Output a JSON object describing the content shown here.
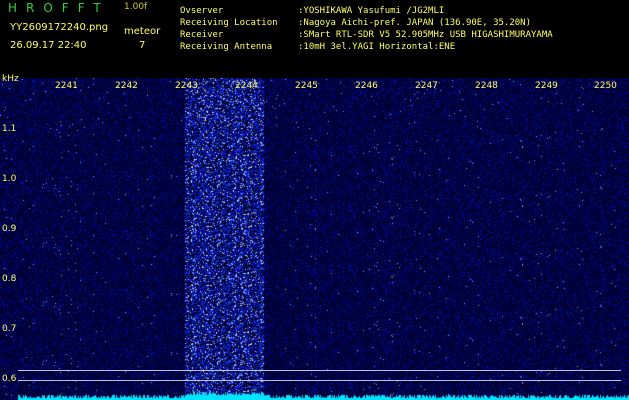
{
  "header": {
    "logo": "HROFFT",
    "version": "1.00f",
    "filename": "YY2609172240.png",
    "timestamp": "26.09.17 22:40",
    "meteor_label": "meteor",
    "meteor_count": "7"
  },
  "info": [
    {
      "label": "Ovserver",
      "value": ":YOSHIKAWA Yasufumi /JG2MLI"
    },
    {
      "label": "Receiving Location",
      "value": ":Nagoya Aichi-pref. JAPAN (136.90E, 35.20N)"
    },
    {
      "label": "Receiver",
      "value": ":SMart RTL-SDR V5 52.905MHz USB HIGASHIMURAYAMA"
    },
    {
      "label": "Receiving Antenna",
      "value": ":10mH 3el.YAGI Horizontal:ENE"
    }
  ],
  "spectrogram": {
    "unit_label": "kHz",
    "time_ticks": [
      "2241",
      "2242",
      "2243",
      "2244",
      "2245",
      "2246",
      "2247",
      "2248",
      "2249",
      "2250"
    ],
    "freq_ticks": [
      "1.1",
      "1.0",
      "0.9",
      "0.8",
      "0.7",
      "0.6"
    ],
    "colors": {
      "background": "#00003a",
      "label": "#ffff66",
      "signal": "#00e5ff",
      "guide_line": "#bfbfe0"
    }
  }
}
